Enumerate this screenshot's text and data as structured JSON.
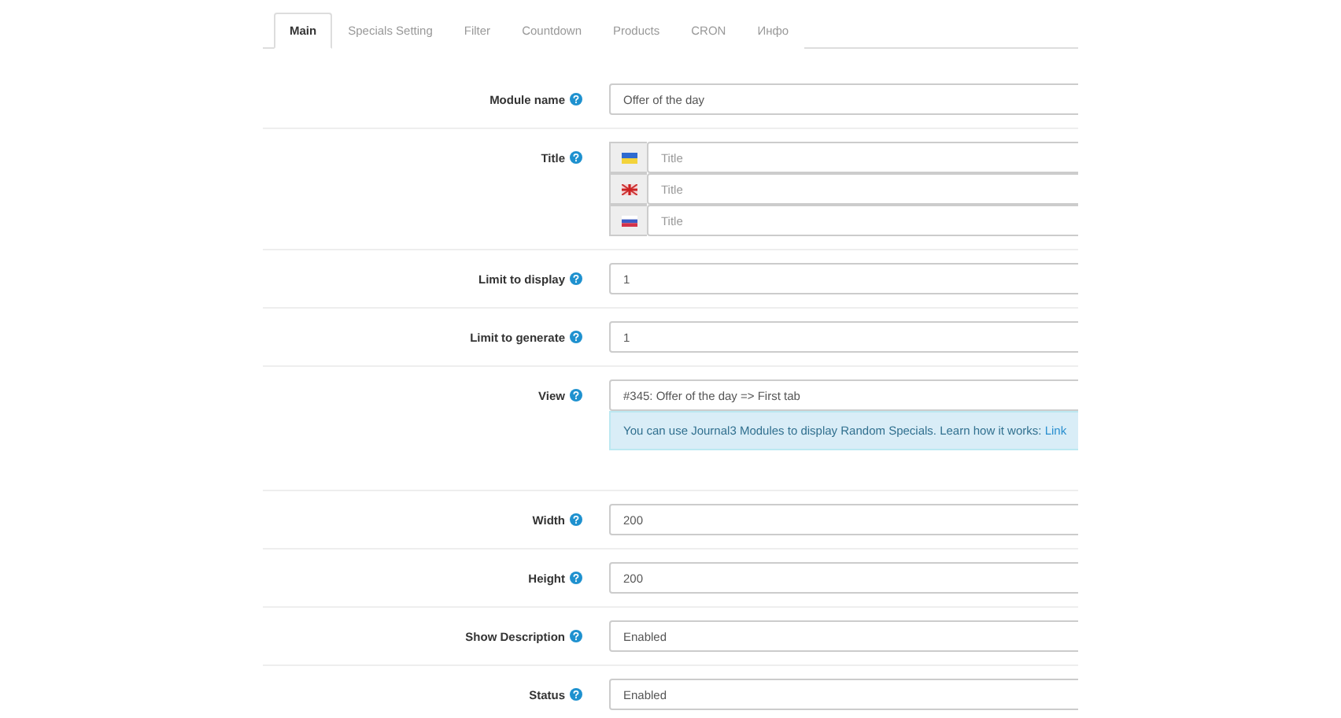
{
  "tabs": [
    {
      "label": "Main",
      "selected": true
    },
    {
      "label": "Specials Setting",
      "selected": false
    },
    {
      "label": "Filter",
      "selected": false
    },
    {
      "label": "Countdown",
      "selected": false
    },
    {
      "label": "Products",
      "selected": false
    },
    {
      "label": "CRON",
      "selected": false
    },
    {
      "label": "Инфо",
      "selected": false
    }
  ],
  "fields": [
    {
      "kind": "text",
      "label": "Module name",
      "value": "Offer of the day"
    },
    {
      "kind": "multilang",
      "label": "Title",
      "items": [
        {
          "kind": "ua",
          "placeholder": "Title"
        },
        {
          "kind": "gb",
          "placeholder": "Title"
        },
        {
          "kind": "ru",
          "placeholder": "Title"
        }
      ]
    },
    {
      "kind": "text",
      "label": "Limit to display",
      "value": "1"
    },
    {
      "kind": "text",
      "label": "Limit to generate",
      "value": "1"
    },
    {
      "kind": "select",
      "label": "View",
      "value": "#345: Offer of the day => First tab",
      "note": {
        "text": "You can use Journal3 Modules to display Random Specials. Learn how it works:",
        "link": "Link"
      }
    },
    {
      "kind": "text",
      "label": "Width",
      "value": "200"
    },
    {
      "kind": "text",
      "label": "Height",
      "value": "200"
    },
    {
      "kind": "select",
      "label": "Show Description",
      "value": "Enabled"
    },
    {
      "kind": "select",
      "label": "Status",
      "value": "Enabled"
    }
  ]
}
